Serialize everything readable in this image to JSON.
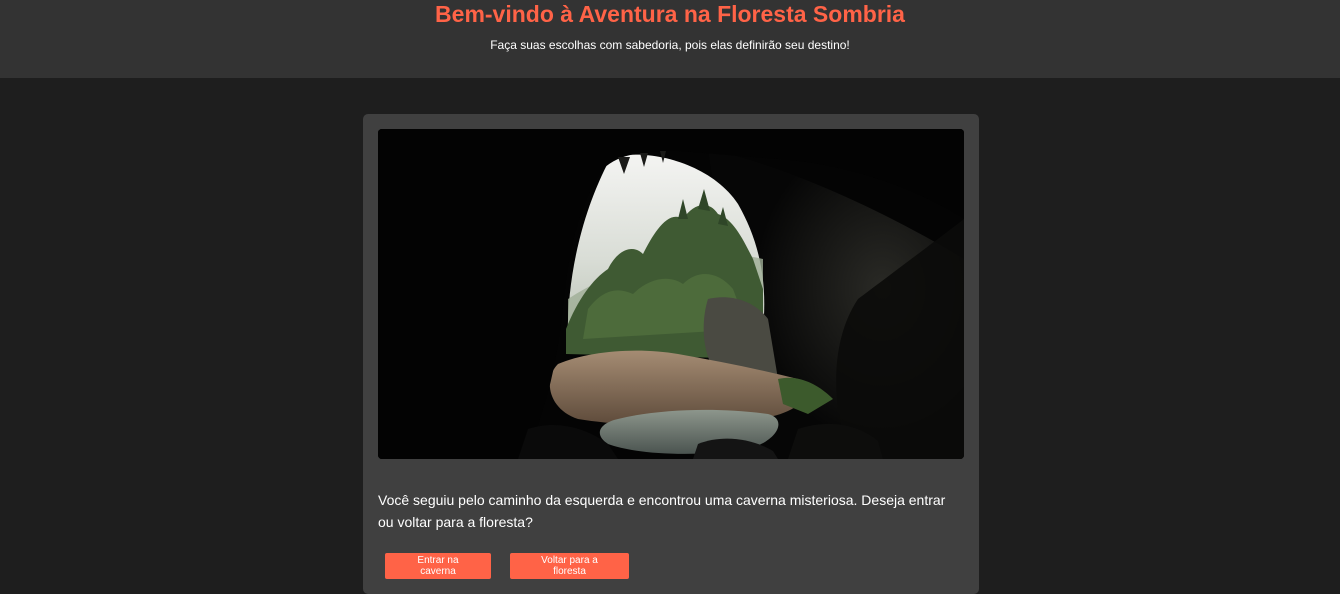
{
  "header": {
    "title": "Bem-vindo à Aventura na Floresta Sombria",
    "subtitle": "Faça suas escolhas com sabedoria, pois elas definirão seu destino!"
  },
  "scene": {
    "image": "cave-entrance-forest-image"
  },
  "story": {
    "text": "Você seguiu pelo caminho da esquerda e encontrou uma caverna misteriosa. Deseja entrar ou voltar para a floresta?"
  },
  "choices": {
    "enter_cave": "Entrar na caverna",
    "back_forest": "Voltar para a floresta"
  },
  "colors": {
    "accent": "#ff6347",
    "header_bg": "#333333",
    "page_bg": "#1e1e1e",
    "card_bg": "#404040"
  }
}
